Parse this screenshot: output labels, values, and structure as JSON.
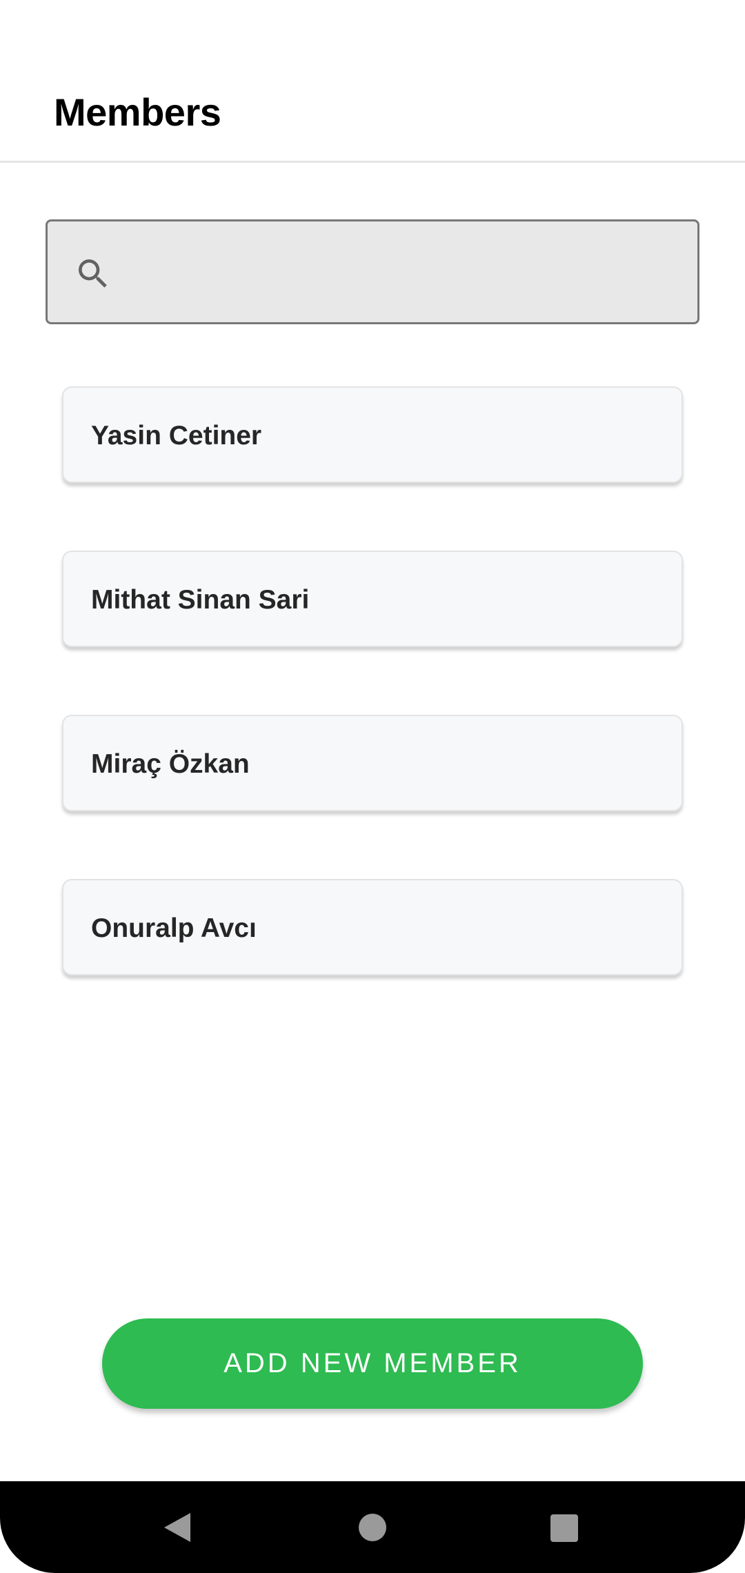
{
  "header": {
    "title": "Members"
  },
  "search": {
    "icon": "search-icon",
    "placeholder": "",
    "value": ""
  },
  "members": [
    {
      "name": "Yasin Cetiner"
    },
    {
      "name": "Mithat Sinan Sari"
    },
    {
      "name": "Miraç Özkan"
    },
    {
      "name": "Onuralp Avcı"
    }
  ],
  "actions": {
    "add_member_label": "ADD NEW MEMBER"
  },
  "navigation": {
    "back_icon": "back-triangle-icon",
    "home_icon": "home-circle-icon",
    "recents_icon": "recents-square-icon"
  },
  "colors": {
    "accent": "#2ebb51",
    "search_background": "#e8e8e9",
    "card_background": "#f7f8fa",
    "nav_background": "#000000"
  }
}
